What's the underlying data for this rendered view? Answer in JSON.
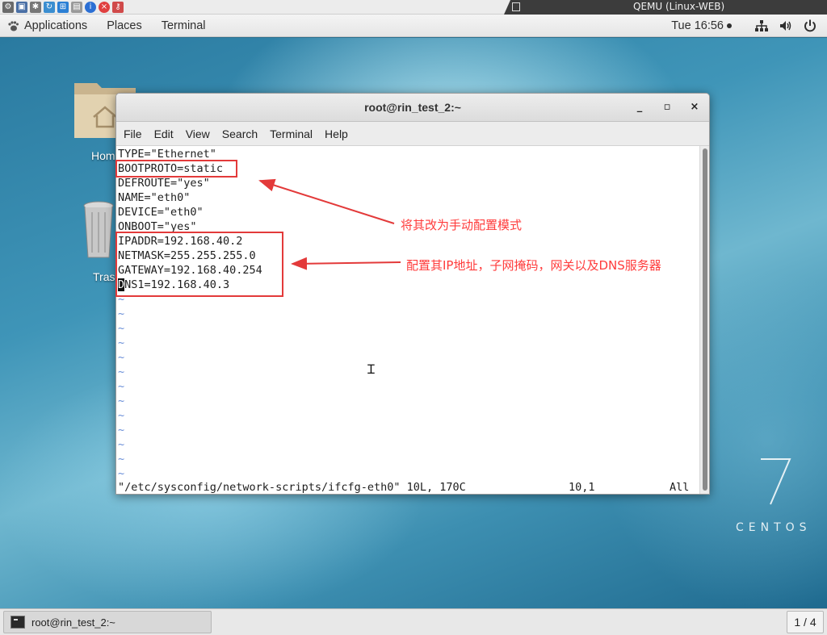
{
  "qemu": {
    "title": "QEMU (Linux-WEB)",
    "toolbar_icons": [
      "settings-icon",
      "fullscreen-icon",
      "gear-icon",
      "refresh-icon",
      "windows-icon",
      "screenshot-icon",
      "info-icon",
      "close-circle-icon",
      "usb-icon"
    ]
  },
  "top_panel": {
    "applications": "Applications",
    "places": "Places",
    "terminal": "Terminal",
    "clock": "Tue 16:56"
  },
  "desktop": {
    "home_label": "Hom",
    "trash_label": "Tras",
    "centos_seven": "7",
    "centos_text": "CENTOS"
  },
  "window": {
    "title": "root@rin_test_2:~",
    "minimize": "_",
    "maximize": "▫",
    "close": "×",
    "menu": [
      "File",
      "Edit",
      "View",
      "Search",
      "Terminal",
      "Help"
    ]
  },
  "terminal": {
    "lines": [
      "TYPE=\"Ethernet\"",
      "BOOTPROTO=static",
      "DEFROUTE=\"yes\"",
      "NAME=\"eth0\"",
      "DEVICE=\"eth0\"",
      "ONBOOT=\"yes\"",
      "IPADDR=192.168.40.2",
      "NETMASK=255.255.255.0",
      "GATEWAY=192.168.40.254"
    ],
    "dns_cursor_char": "D",
    "dns_rest": "NS1=192.168.40.3",
    "tilde": "~",
    "status_file": "\"/etc/sysconfig/network-scripts/ifcfg-eth0\" 10L, 170C",
    "status_pos": "10,1",
    "status_all": "All"
  },
  "annotations": {
    "note1": "将其改为手动配置模式",
    "note2": "配置其IP地址，子网掩码，网关以及DNS服务器",
    "color": "#e33a3a"
  },
  "taskbar": {
    "task_label": "root@rin_test_2:~",
    "workspace": "1 / 4"
  }
}
